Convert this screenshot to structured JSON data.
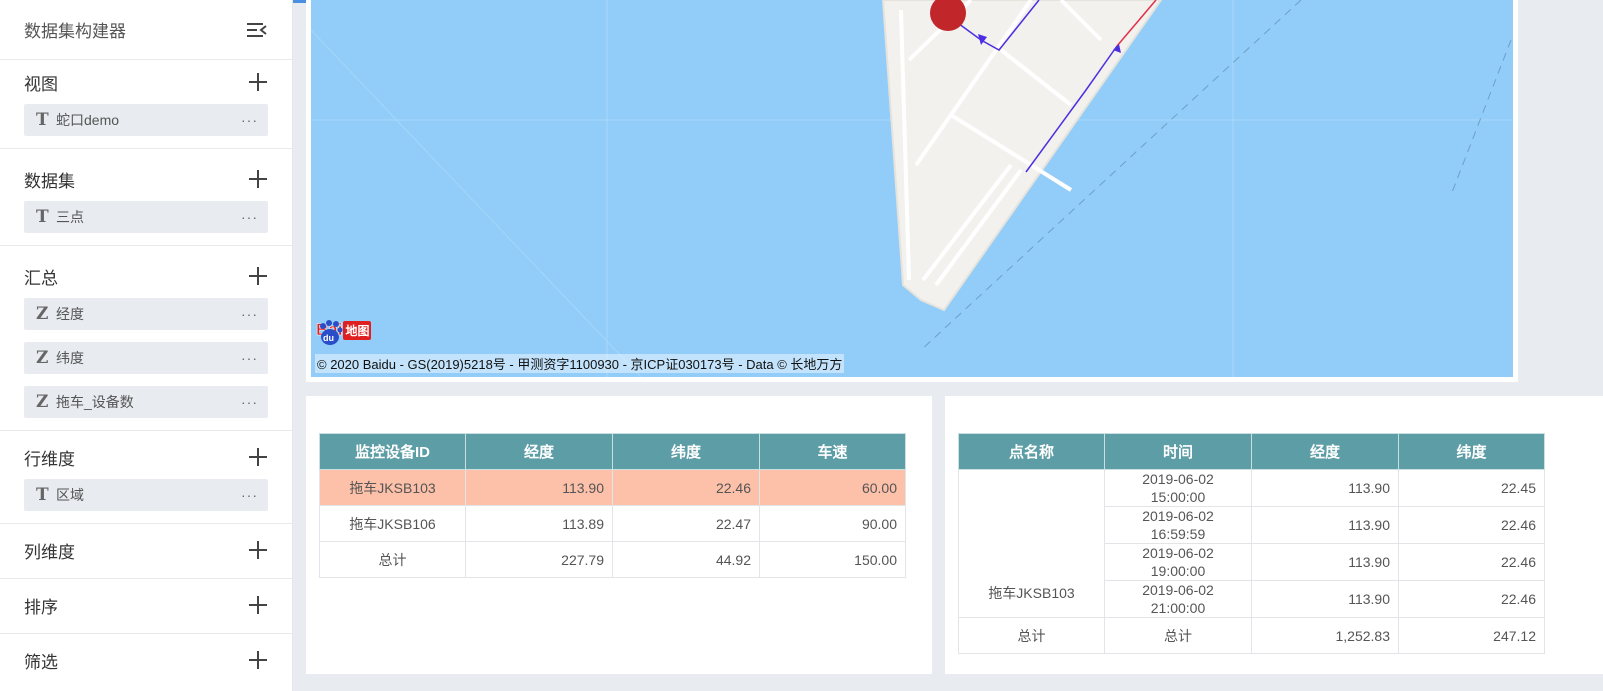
{
  "sidebar": {
    "title": "数据集构建器",
    "sections": {
      "view": {
        "title": "视图",
        "items": [
          {
            "type": "T",
            "label": "蛇口demo"
          }
        ]
      },
      "dataset": {
        "title": "数据集",
        "items": [
          {
            "type": "T",
            "label": "三点"
          }
        ]
      },
      "summary": {
        "title": "汇总",
        "items": [
          {
            "type": "Z",
            "label": "经度"
          },
          {
            "type": "Z",
            "label": "纬度"
          },
          {
            "type": "Z",
            "label": "拖车_设备数"
          }
        ]
      },
      "row_dim": {
        "title": "行维度",
        "items": [
          {
            "type": "T",
            "label": "区域"
          }
        ]
      },
      "col_dim": {
        "title": "列维度"
      },
      "sort": {
        "title": "排序"
      },
      "filter": {
        "title": "筛选"
      }
    },
    "more": "···"
  },
  "map": {
    "copyright": "© 2020 Baidu - GS(2019)5218号 - 甲测资字1100930 - 京ICP证030173号 - Data © 长地万方",
    "logo_text": "Bai",
    "logo_du": "du",
    "logo_cn": "地图",
    "colors": {
      "water": "#91cdf8",
      "land": "#f2f1ee",
      "marker": "#c0262a"
    }
  },
  "table_left": {
    "headers": [
      "监控设备ID",
      "经度",
      "纬度",
      "车速"
    ],
    "rows": [
      [
        "拖车JKSB103",
        "113.90",
        "22.46",
        "60.00"
      ],
      [
        "拖车JKSB106",
        "113.89",
        "22.47",
        "90.00"
      ],
      [
        "总计",
        "227.79",
        "44.92",
        "150.00"
      ]
    ]
  },
  "table_right": {
    "headers": [
      "点名称",
      "时间",
      "经度",
      "纬度"
    ],
    "group": "拖车JKSB103",
    "rows": [
      {
        "date": "2019-06-02",
        "time": "15:00:00",
        "lng": "113.90",
        "lat": "22.45"
      },
      {
        "date": "2019-06-02",
        "time": "16:59:59",
        "lng": "113.90",
        "lat": "22.46"
      },
      {
        "date": "2019-06-02",
        "time": "19:00:00",
        "lng": "113.90",
        "lat": "22.46"
      },
      {
        "date": "2019-06-02",
        "time": "21:00:00",
        "lng": "113.90",
        "lat": "22.46"
      }
    ],
    "total": [
      "总计",
      "总计",
      "1,252.83",
      "247.12"
    ]
  }
}
